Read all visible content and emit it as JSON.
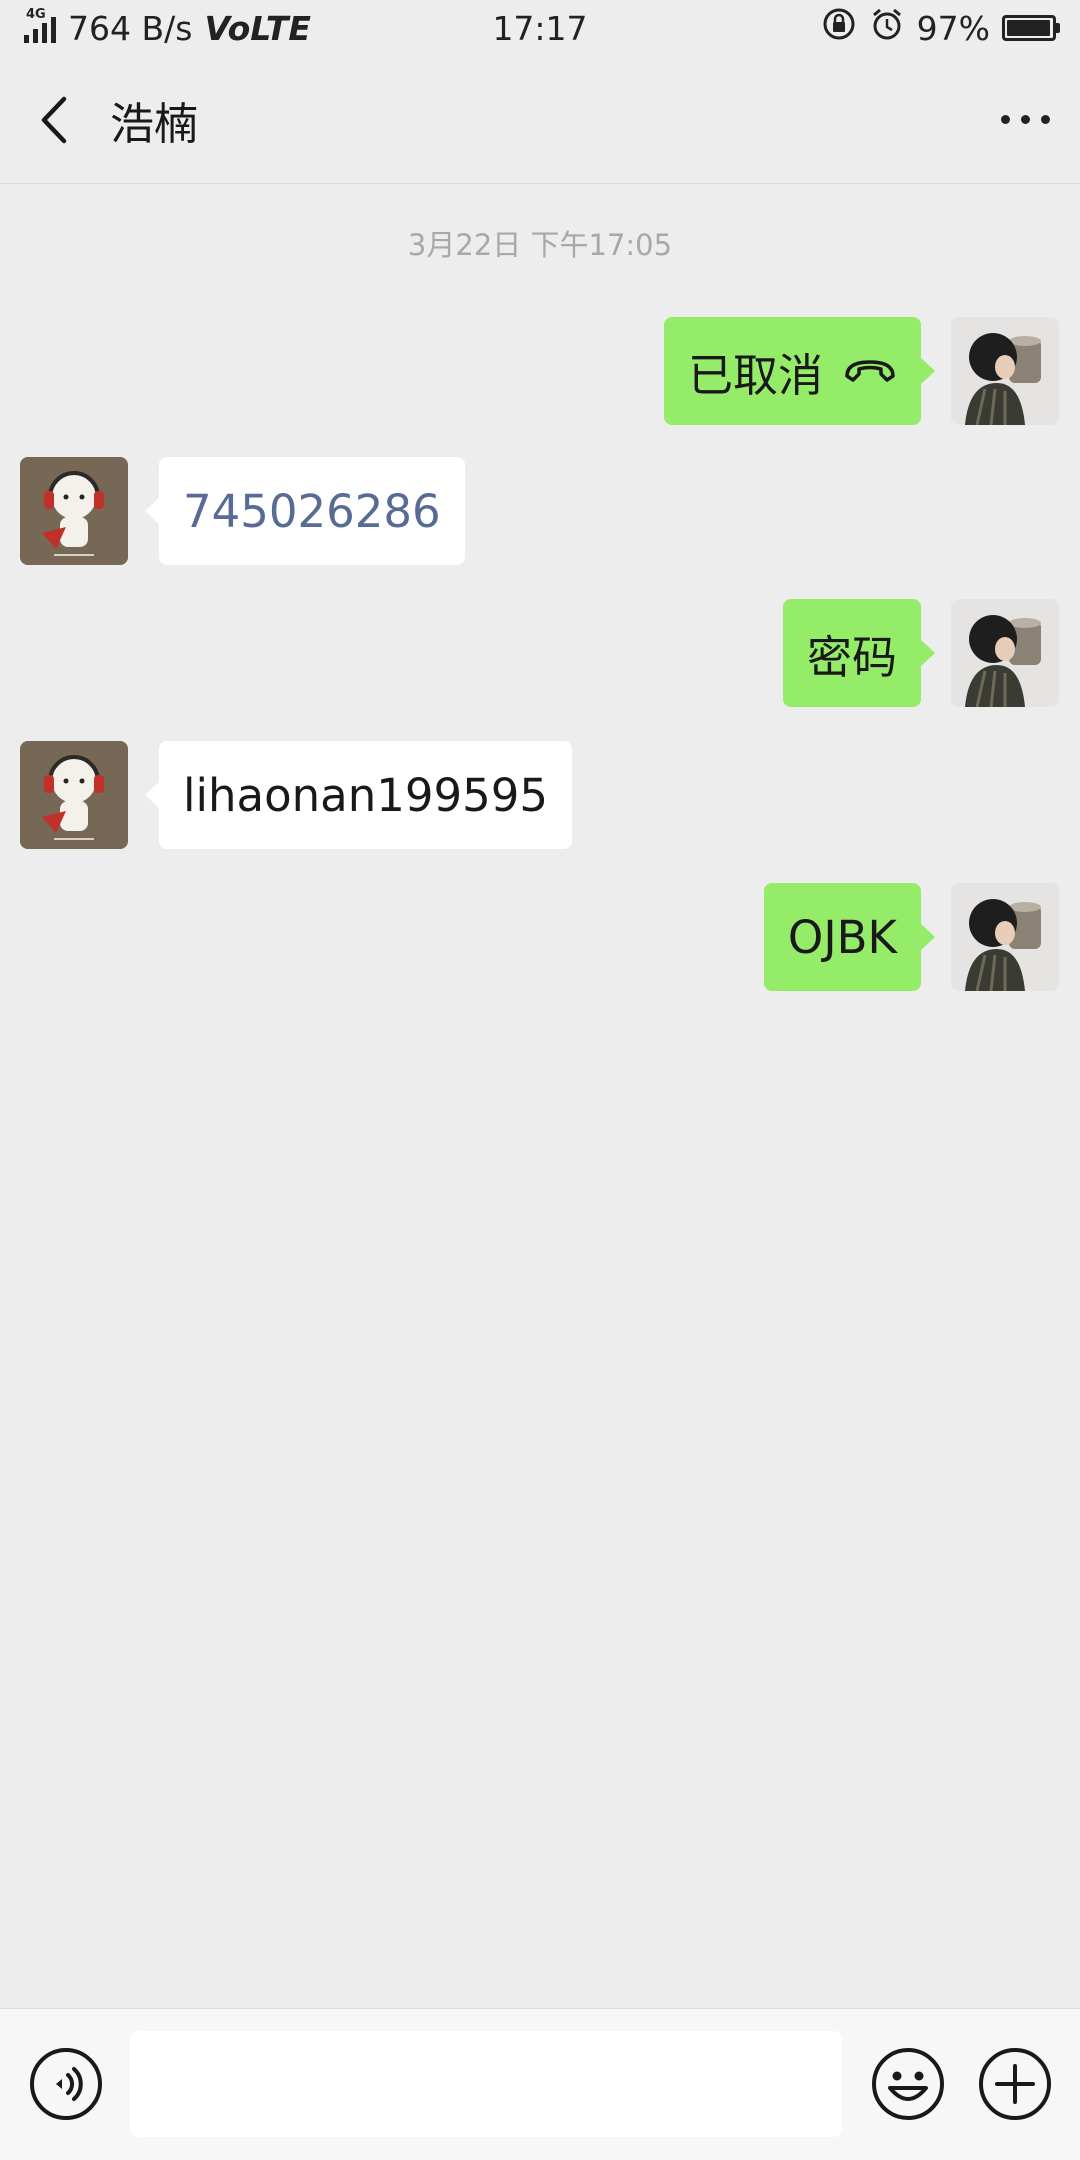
{
  "status_bar": {
    "network_type": "4G",
    "speed": "764 B/s",
    "volte": "VoLTE",
    "time": "17:17",
    "battery_percent": "97%",
    "battery_level": 0.97
  },
  "nav": {
    "title": "浩楠"
  },
  "chat": {
    "timestamp": "3月22日 下午17:05",
    "messages": [
      {
        "direction": "outgoing",
        "text": "已取消",
        "icon": "phone-hangup-icon",
        "avatar": "avatar-me"
      },
      {
        "direction": "incoming",
        "text": "745026286",
        "style": "link",
        "avatar": "avatar-contact"
      },
      {
        "direction": "outgoing",
        "text": "密码",
        "avatar": "avatar-me"
      },
      {
        "direction": "incoming",
        "text": "lihaonan199595",
        "avatar": "avatar-contact"
      },
      {
        "direction": "outgoing",
        "text": "OJBK",
        "avatar": "avatar-me"
      }
    ]
  },
  "input_bar": {
    "value": "",
    "placeholder": ""
  },
  "colors": {
    "background": "#ededed",
    "outgoing_bubble": "#95ec69",
    "incoming_bubble": "#ffffff",
    "link": "#576b95",
    "timestamp": "#a8a8a8"
  }
}
